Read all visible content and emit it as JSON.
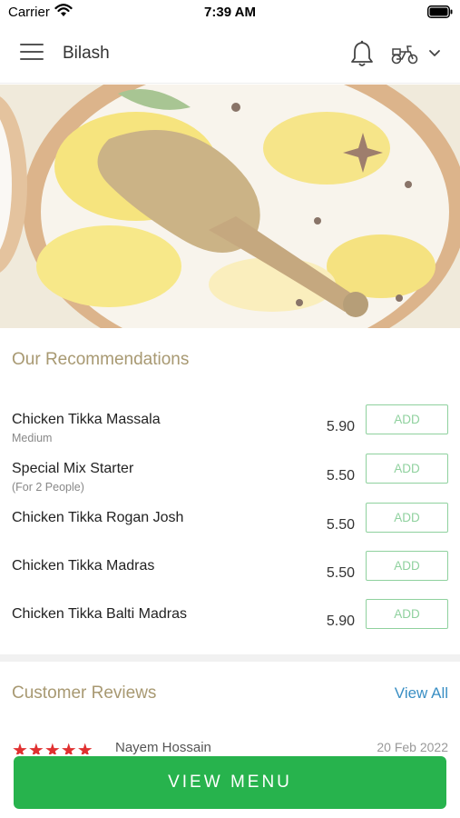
{
  "status": {
    "carrier": "Carrier",
    "time": "7:39 AM"
  },
  "header": {
    "title": "Bilash"
  },
  "recommendations": {
    "title": "Our Recommendations",
    "items": [
      {
        "name": "Chicken Tikka Massala",
        "sub": "Medium",
        "price": "5.90",
        "action": "ADD"
      },
      {
        "name": "Special Mix Starter",
        "sub": "(For 2 People)",
        "price": "5.50",
        "action": "ADD"
      },
      {
        "name": "Chicken Tikka Rogan Josh",
        "sub": "",
        "price": "5.50",
        "action": "ADD"
      },
      {
        "name": "Chicken Tikka Madras",
        "sub": "",
        "price": "5.50",
        "action": "ADD"
      },
      {
        "name": "Chicken Tikka Balti Madras",
        "sub": "",
        "price": "5.90",
        "action": "ADD"
      }
    ]
  },
  "reviews": {
    "title": "Customer Reviews",
    "view_all": "View All",
    "first": {
      "stars": "★★★★★",
      "name": "Nayem Hossain",
      "date": "20 Feb 2022"
    }
  },
  "footer": {
    "view_menu": "VIEW MENU"
  },
  "colors": {
    "accent_green": "#27b34d",
    "add_green": "#8fd19e",
    "section_title": "#a89972",
    "link_blue": "#3a8fc4",
    "star_red": "#e03030"
  }
}
